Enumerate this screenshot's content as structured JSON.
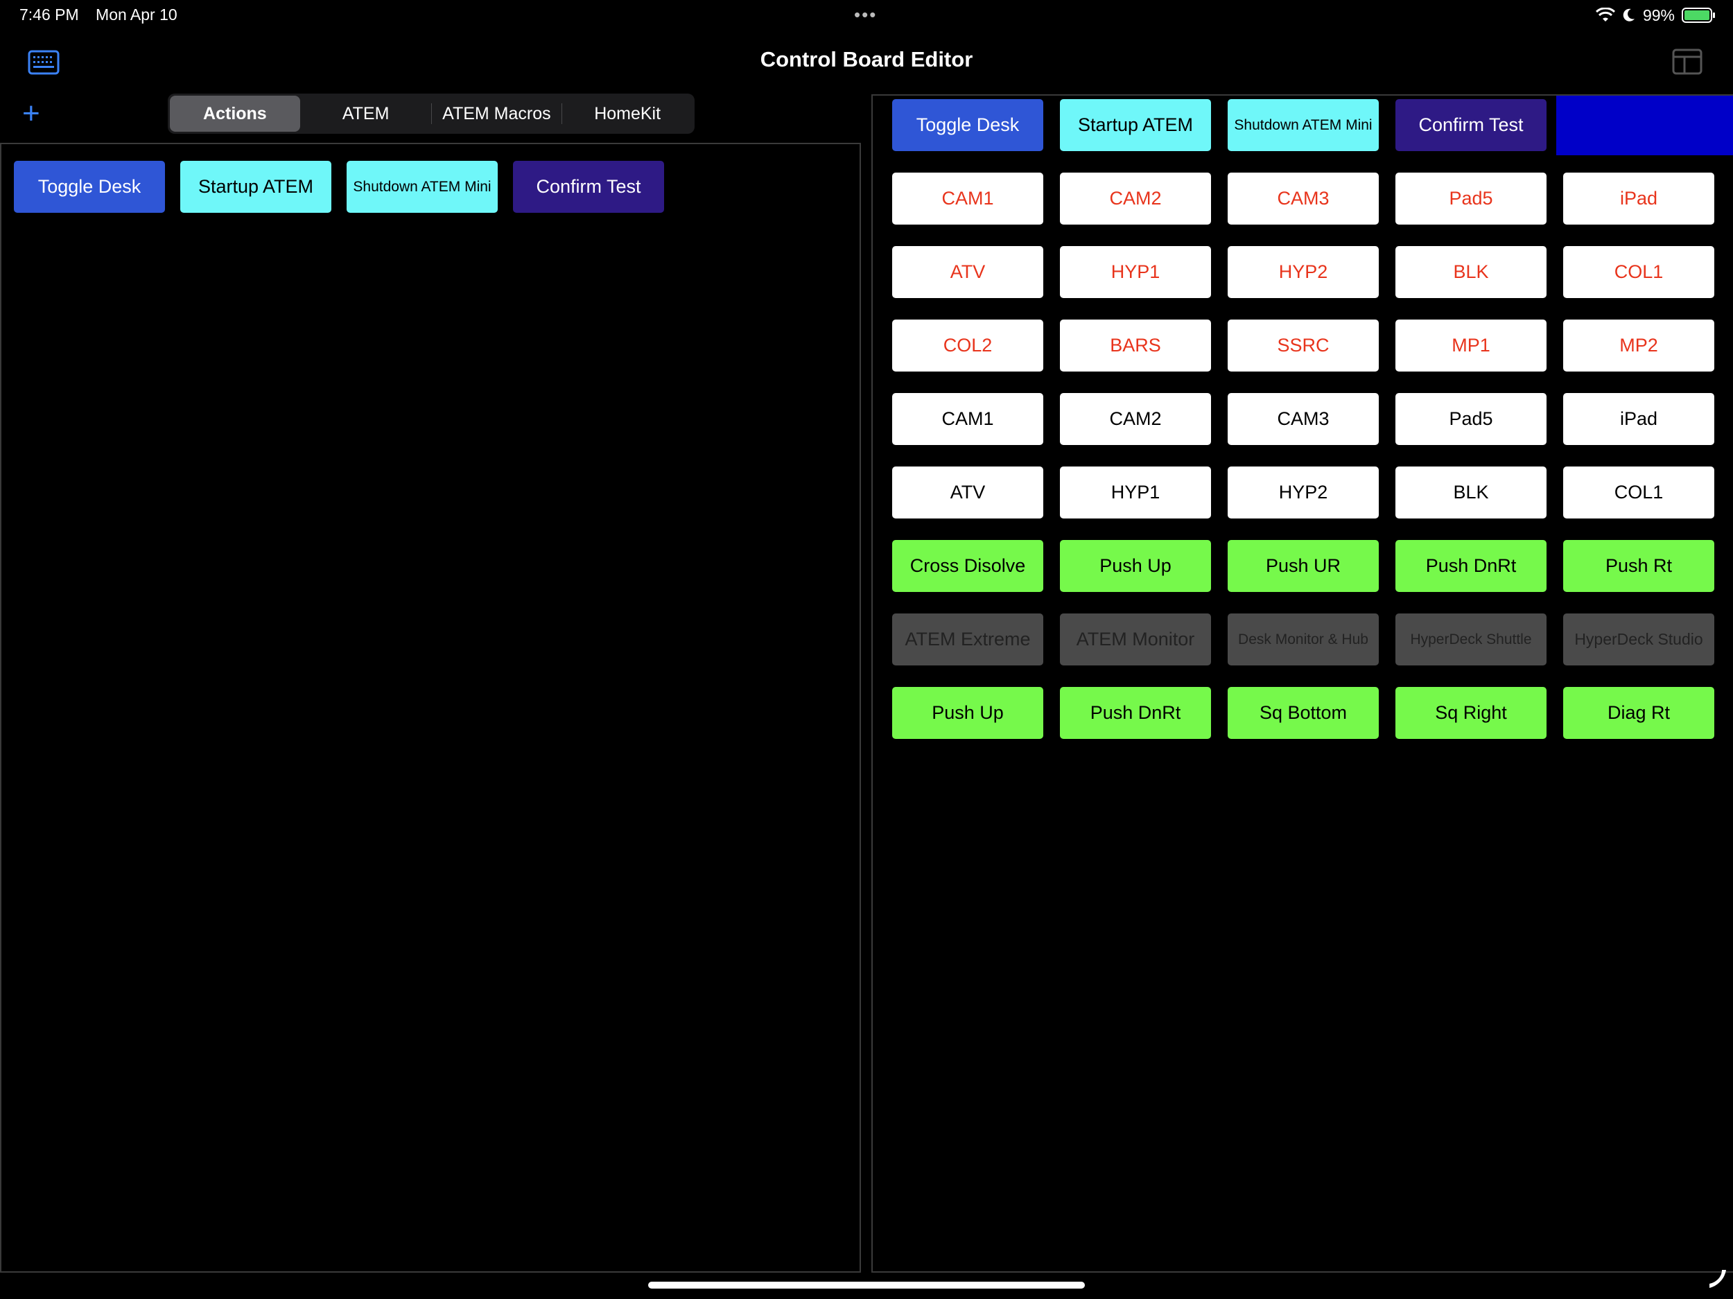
{
  "status_bar": {
    "time": "7:46 PM",
    "date": "Mon Apr 10",
    "battery": "99%",
    "battery_level": 0.99
  },
  "nav": {
    "title": "Control Board Editor",
    "left_icon": "keyboard-icon",
    "right_icon": "layout-icon",
    "add_icon": "plus-icon"
  },
  "tabs": [
    {
      "label": "Actions",
      "selected": true
    },
    {
      "label": "ATEM",
      "selected": false
    },
    {
      "label": "ATEM Macros",
      "selected": false
    },
    {
      "label": "HomeKit",
      "selected": false
    }
  ],
  "colors": {
    "blue": "#2f56d6",
    "cyan": "#6ff7f9",
    "purple": "#2e1a85",
    "white": "#ffffff",
    "green": "#76f94b",
    "gray": "#4a4a4a",
    "red_text": "#e8341c",
    "highlight": "#0000c8"
  },
  "library_buttons": [
    {
      "label": "Toggle Desk",
      "style": "blue"
    },
    {
      "label": "Startup ATEM",
      "style": "cyan"
    },
    {
      "label": "Shutdown ATEM Mini",
      "style": "cyan"
    },
    {
      "label": "Confirm Test",
      "style": "purple"
    }
  ],
  "board_rows": [
    [
      {
        "label": "Toggle Desk",
        "style": "blue"
      },
      {
        "label": "Startup ATEM",
        "style": "cyan"
      },
      {
        "label": "Shutdown ATEM Mini",
        "style": "cyan"
      },
      {
        "label": "Confirm Test",
        "style": "purple"
      }
    ],
    [
      {
        "label": "CAM1",
        "style": "white-red"
      },
      {
        "label": "CAM2",
        "style": "white-red"
      },
      {
        "label": "CAM3",
        "style": "white-red"
      },
      {
        "label": "Pad5",
        "style": "white-red"
      },
      {
        "label": "iPad",
        "style": "white-red"
      }
    ],
    [
      {
        "label": "ATV",
        "style": "white-red"
      },
      {
        "label": "HYP1",
        "style": "white-red"
      },
      {
        "label": "HYP2",
        "style": "white-red"
      },
      {
        "label": "BLK",
        "style": "white-red"
      },
      {
        "label": "COL1",
        "style": "white-red"
      }
    ],
    [
      {
        "label": "COL2",
        "style": "white-red"
      },
      {
        "label": "BARS",
        "style": "white-red"
      },
      {
        "label": "SSRC",
        "style": "white-red"
      },
      {
        "label": "MP1",
        "style": "white-red"
      },
      {
        "label": "MP2",
        "style": "white-red"
      }
    ],
    [
      {
        "label": "CAM1",
        "style": "white-black"
      },
      {
        "label": "CAM2",
        "style": "white-black"
      },
      {
        "label": "CAM3",
        "style": "white-black"
      },
      {
        "label": "Pad5",
        "style": "white-black"
      },
      {
        "label": "iPad",
        "style": "white-black"
      }
    ],
    [
      {
        "label": "ATV",
        "style": "white-black"
      },
      {
        "label": "HYP1",
        "style": "white-black"
      },
      {
        "label": "HYP2",
        "style": "white-black"
      },
      {
        "label": "BLK",
        "style": "white-black"
      },
      {
        "label": "COL1",
        "style": "white-black"
      }
    ],
    [
      {
        "label": "Cross Disolve",
        "style": "green"
      },
      {
        "label": "Push Up",
        "style": "green"
      },
      {
        "label": "Push UR",
        "style": "green"
      },
      {
        "label": "Push DnRt",
        "style": "green"
      },
      {
        "label": "Push Rt",
        "style": "green"
      }
    ],
    [
      {
        "label": "ATEM Extreme",
        "style": "gray"
      },
      {
        "label": "ATEM Monitor",
        "style": "gray"
      },
      {
        "label": "Desk Monitor & Hub",
        "style": "gray"
      },
      {
        "label": "HyperDeck Shuttle",
        "style": "gray"
      },
      {
        "label": "HyperDeck Studio",
        "style": "gray"
      }
    ],
    [
      {
        "label": "Push Up",
        "style": "green"
      },
      {
        "label": "Push DnRt",
        "style": "green"
      },
      {
        "label": "Sq Bottom",
        "style": "green"
      },
      {
        "label": "Sq Right",
        "style": "green"
      },
      {
        "label": "Diag Rt",
        "style": "green"
      }
    ]
  ]
}
